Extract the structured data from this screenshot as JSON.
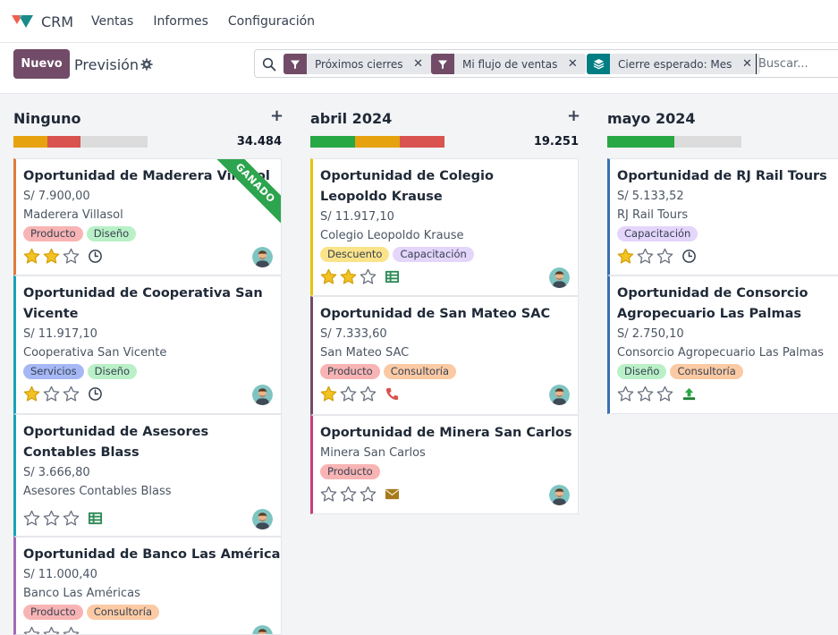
{
  "app": {
    "name": "CRM",
    "menu": [
      "Ventas",
      "Informes",
      "Configuración"
    ]
  },
  "control": {
    "new_label": "Nuevo",
    "view_title": "Previsión",
    "search_placeholder": "Buscar...",
    "facets": [
      {
        "label": "Próximos cierres",
        "icon": "filter-icon",
        "color": "#714b67"
      },
      {
        "label": "Mi flujo de ventas",
        "icon": "filter-icon",
        "color": "#714b67"
      },
      {
        "label": "Cierre esperado: Mes",
        "icon": "group-by-layers-icon",
        "color": "#017e84"
      }
    ]
  },
  "colors": {
    "green": "#28a745",
    "orange": "#e7a20f",
    "red": "#d9534f",
    "grey": "#dcdcdc",
    "tags": {
      "Producto": "#f8b4b4",
      "Diseño": "#b9f0c7",
      "Servicios": "#a5b8f5",
      "Descuento": "#fbe38a",
      "Capacitación": "#e4d5fb",
      "Consultoría": "#fbcaa4"
    }
  },
  "columns": [
    {
      "title": "Ninguno",
      "total": "34.484",
      "cards": [
        {
          "title": "Oportunidad de Maderera Villasol",
          "amount": "S/ 7.900,00",
          "partner": "Maderera Villasol",
          "tags": [
            "Producto",
            "Diseño"
          ],
          "stars": 2,
          "activity": "clock-icon",
          "ribbon": "GANADO"
        },
        {
          "title": "Oportunidad de Cooperativa San Vicente",
          "amount": "S/ 11.917,10",
          "partner": "Cooperativa San Vicente",
          "tags": [
            "Servicios",
            "Diseño"
          ],
          "stars": 1,
          "activity": "clock-icon"
        },
        {
          "title": "Oportunidad de Asesores Contables Blass",
          "amount": "S/ 3.666,80",
          "partner": "Asesores Contables Blass",
          "tags": [],
          "stars": 0,
          "activity": "todo-list-icon"
        },
        {
          "title": "Oportunidad de Banco Las Américas",
          "amount": "S/ 11.000,40",
          "partner": "Banco Las Américas",
          "tags": [
            "Producto",
            "Consultoría"
          ],
          "stars": 0,
          "activity": ""
        }
      ]
    },
    {
      "title": "abril 2024",
      "total": "19.251",
      "cards": [
        {
          "title": "Oportunidad de Colegio Leopoldo Krause",
          "amount": "S/ 11.917,10",
          "partner": "Colegio Leopoldo Krause",
          "tags": [
            "Descuento",
            "Capacitación"
          ],
          "stars": 2,
          "activity": "todo-list-icon"
        },
        {
          "title": "Oportunidad de San Mateo SAC",
          "amount": "S/ 7.333,60",
          "partner": "San Mateo SAC",
          "tags": [
            "Producto",
            "Consultoría"
          ],
          "stars": 1,
          "activity": "phone-icon"
        },
        {
          "title": "Oportunidad de Minera San Carlos",
          "amount": "",
          "partner": "Minera San Carlos",
          "tags": [
            "Producto"
          ],
          "stars": 0,
          "activity": "envelope-icon"
        }
      ]
    },
    {
      "title": "mayo 2024",
      "total": "",
      "cards": [
        {
          "title": "Oportunidad de RJ Rail Tours",
          "amount": "S/ 5.133,52",
          "partner": "RJ Rail Tours",
          "tags": [
            "Capacitación"
          ],
          "stars": 1,
          "activity": "clock-icon"
        },
        {
          "title": "Oportunidad de Consorcio Agropecuario Las Palmas",
          "amount": "S/ 2.750,10",
          "partner": "Consorcio Agropecuario Las Palmas",
          "tags": [
            "Diseño",
            "Consultoría"
          ],
          "stars": 0,
          "activity": "upload-icon"
        }
      ]
    }
  ]
}
